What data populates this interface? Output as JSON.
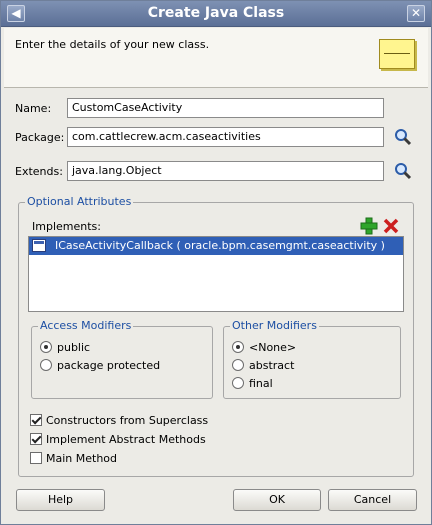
{
  "window": {
    "title": "Create Java Class",
    "menu_icon": "window-menu-icon",
    "close_icon": "close-icon"
  },
  "header": {
    "instruction": "Enter the details of your new class.",
    "icon": "java-class-icon"
  },
  "fields": {
    "name_label": "Name:",
    "name_value": "CustomCaseActivity",
    "package_label": "Package:",
    "package_value": "com.cattlecrew.acm.caseactivities",
    "extends_label": "Extends:",
    "extends_value": "java.lang.Object"
  },
  "optional_attributes": {
    "title": "Optional Attributes",
    "implements_label": "Implements:",
    "implements_items": [
      {
        "text": "ICaseActivityCallback ( oracle.bpm.casemgmt.caseactivity )"
      }
    ]
  },
  "access_modifiers": {
    "title": "Access Modifiers",
    "options": [
      "public",
      "package protected"
    ],
    "selected": "public"
  },
  "other_modifiers": {
    "title": "Other Modifiers",
    "options": [
      "<None>",
      "abstract",
      "final"
    ],
    "selected": "<None>"
  },
  "options": {
    "constructors": {
      "label": "Constructors from Superclass",
      "checked": true
    },
    "implement_abstract": {
      "label": "Implement Abstract Methods",
      "checked": true
    },
    "main_method": {
      "label": "Main Method",
      "checked": false
    }
  },
  "buttons": {
    "help": "Help",
    "ok": "OK",
    "cancel": "Cancel"
  }
}
